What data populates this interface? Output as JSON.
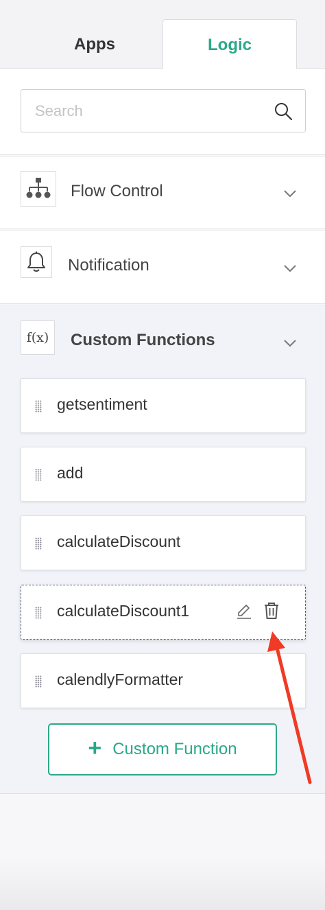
{
  "tabs": {
    "apps": "Apps",
    "logic": "Logic",
    "active": "logic",
    "active_color": "#2ba888"
  },
  "search": {
    "placeholder": "Search",
    "value": "",
    "icon": "search-icon"
  },
  "sections": {
    "flow_control": {
      "label": "Flow Control",
      "icon": "org-chart-icon",
      "expanded": false
    },
    "notification": {
      "label": "Notification",
      "icon": "bell-icon",
      "expanded": false
    },
    "custom_functions": {
      "label": "Custom Functions",
      "icon_text": "f(x)",
      "icon": "function-icon",
      "expanded": true,
      "items": [
        {
          "label": "getsentiment"
        },
        {
          "label": "add"
        },
        {
          "label": "calculateDiscount"
        },
        {
          "label": "calculateDiscount1",
          "hovered": true,
          "actions": [
            "pencil-icon",
            "trash-icon"
          ]
        },
        {
          "label": "calendlyFormatter"
        }
      ],
      "add_button": {
        "plus": "+",
        "label": "Custom Function"
      }
    }
  },
  "annotation": {
    "arrow_color": "#f03a24"
  }
}
